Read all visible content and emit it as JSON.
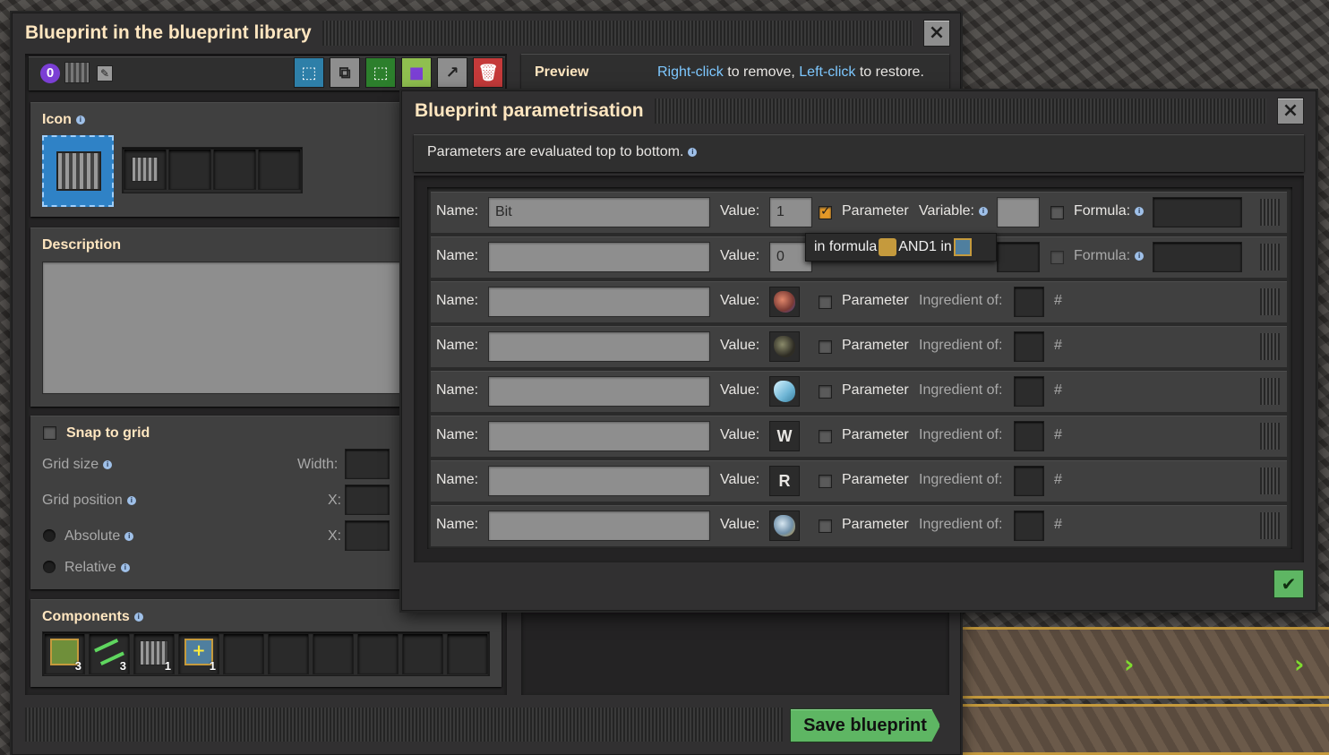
{
  "library_window": {
    "title": "Blueprint in the blueprint library",
    "signal_number": "0",
    "preview_label": "Preview",
    "preview_hint": {
      "part1": "Right-click",
      "part2": " to remove, ",
      "part3": "Left-click",
      "part4": " to restore."
    },
    "icon_label": "Icon",
    "description_label": "Description",
    "snap_to_grid_label": "Snap to grid",
    "grid_size_label": "Grid size",
    "width_label": "Width:",
    "grid_position_label": "Grid position",
    "x_label_1": "X:",
    "absolute_label": "Absolute",
    "x_label_2": "X:",
    "relative_label": "Relative",
    "components_label": "Components",
    "components": [
      {
        "icon": "arithmetic-combinator-icon",
        "count": "3"
      },
      {
        "icon": "green-wire-icon",
        "count": "3"
      },
      {
        "icon": "constant-combinator-icon",
        "count": "1"
      },
      {
        "icon": "decider-combinator-icon",
        "count": "1"
      }
    ],
    "save_label": "Save blueprint"
  },
  "param_window": {
    "title": "Blueprint parametrisation",
    "hint": "Parameters are evaluated top to bottom.",
    "tooltip": {
      "part1": "in formula ",
      "part2": "AND1 in "
    },
    "rows": [
      {
        "name_label": "Name:",
        "name_value": "Bit",
        "value_label": "Value:",
        "value": "1",
        "param_label": "Parameter",
        "param_checked": true,
        "variable_label": "Variable:",
        "formula_label": "Formula:"
      },
      {
        "name_label": "Name:",
        "name_value": "",
        "value_label": "Value:",
        "value": "0",
        "formula_label": "Formula:"
      },
      {
        "name_label": "Name:",
        "name_value": "",
        "value_label": "Value:",
        "value_icon": "copper-ore-icon",
        "param_label": "Parameter",
        "ingredient_label": "Ingredient of:",
        "hash": "#"
      },
      {
        "name_label": "Name:",
        "name_value": "",
        "value_label": "Value:",
        "value_icon": "coal-icon",
        "param_label": "Parameter",
        "ingredient_label": "Ingredient of:",
        "hash": "#"
      },
      {
        "name_label": "Name:",
        "name_value": "",
        "value_label": "Value:",
        "value_icon": "ice-icon",
        "param_label": "Parameter",
        "ingredient_label": "Ingredient of:",
        "hash": "#"
      },
      {
        "name_label": "Name:",
        "name_value": "",
        "value_label": "Value:",
        "value_text": "W",
        "param_label": "Parameter",
        "ingredient_label": "Ingredient of:",
        "hash": "#"
      },
      {
        "name_label": "Name:",
        "name_value": "",
        "value_label": "Value:",
        "value_text": "R",
        "param_label": "Parameter",
        "ingredient_label": "Ingredient of:",
        "hash": "#"
      },
      {
        "name_label": "Name:",
        "name_value": "",
        "value_label": "Value:",
        "value_icon": "iron-ore-icon",
        "param_label": "Parameter",
        "ingredient_label": "Ingredient of:",
        "hash": "#"
      }
    ]
  }
}
